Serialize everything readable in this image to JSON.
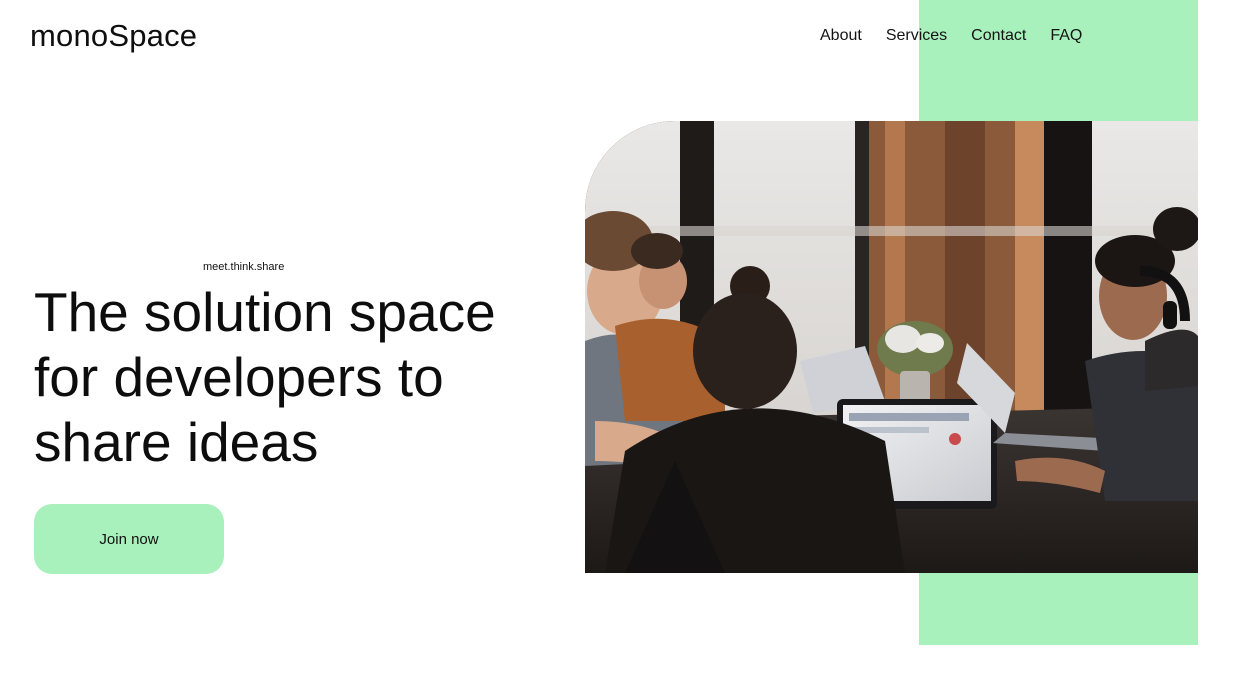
{
  "header": {
    "logo": "monoSpace",
    "nav": [
      {
        "label": "About"
      },
      {
        "label": "Services"
      },
      {
        "label": "Contact"
      },
      {
        "label": "FAQ"
      }
    ]
  },
  "hero": {
    "tagline": "meet.think.share",
    "headline": "The  solution space\nfor developers to\nshare ideas",
    "cta_label": "Join now",
    "image_subject": "developers-collaborating-photo"
  },
  "colors": {
    "accent": "#a8f0bc",
    "text": "#111111",
    "background": "#ffffff"
  }
}
